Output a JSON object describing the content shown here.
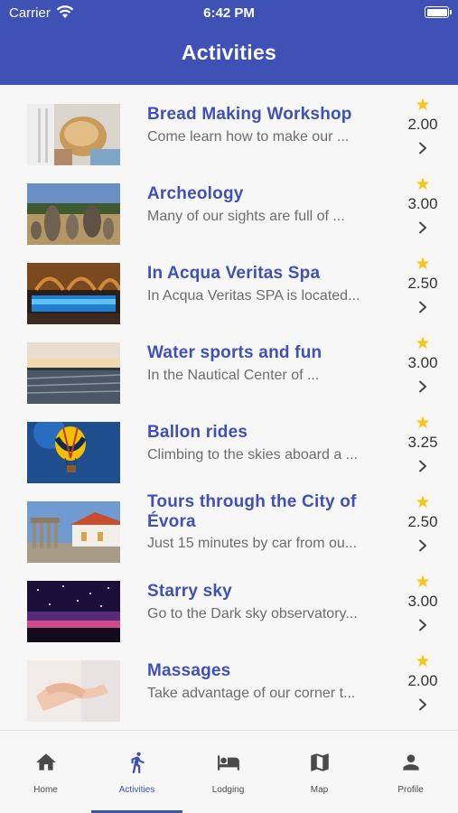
{
  "status_bar": {
    "carrier": "Carrier",
    "time": "6:42 PM"
  },
  "header": {
    "title": "Activities"
  },
  "activities": [
    {
      "name": "Bread Making Workshop",
      "description": "Come learn how to make our ...",
      "rating": "2.00"
    },
    {
      "name": "Archeology",
      "description": "Many of our sights are full of ...",
      "rating": "3.00"
    },
    {
      "name": "In Acqua Veritas Spa",
      "description": "In Acqua Veritas SPA is located...",
      "rating": "2.50"
    },
    {
      "name": "Water sports and fun",
      "description": "In the Nautical Center of ...",
      "rating": "3.00"
    },
    {
      "name": "Ballon rides",
      "description": "Climbing to the skies aboard a ...",
      "rating": "3.25"
    },
    {
      "name": "Tours through the City of Évora",
      "description": "Just 15 minutes by car from ou...",
      "rating": "2.50"
    },
    {
      "name": "Starry sky",
      "description": "Go to the Dark sky observatory...",
      "rating": "3.00"
    },
    {
      "name": "Massages",
      "description": "Take advantage of our corner t...",
      "rating": "2.00"
    }
  ],
  "tabs": [
    {
      "label": "Home",
      "icon": "home-icon"
    },
    {
      "label": "Activities",
      "icon": "run-icon"
    },
    {
      "label": "Lodging",
      "icon": "bed-icon"
    },
    {
      "label": "Map",
      "icon": "map-icon"
    },
    {
      "label": "Profile",
      "icon": "person-icon"
    }
  ],
  "active_tab": "Activities",
  "colors": {
    "primary": "#3f51b5",
    "star": "#f5c518",
    "background": "#f7f7f7"
  }
}
